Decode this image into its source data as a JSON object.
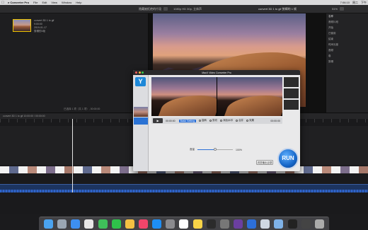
{
  "menubar": {
    "apple": "",
    "app_name": "e Converter Pro",
    "menus": [
      "File",
      "Edit",
      "View",
      "Window",
      "Help"
    ],
    "status_right": [
      "7:06:10",
      "周二",
      "下午"
    ]
  },
  "fcp_toolbar": {
    "library_title": "隐藏被拒绝的片段",
    "viewer_meta": "1080p HD 30p, 立体声",
    "project_name": "convert 3D 1 to gif 剪辑的 1 帧",
    "zoom": "51%",
    "view": "显示"
  },
  "browser": {
    "clip_name": "convert 3D 1 to gif",
    "clip_meta": [
      "9:00:00",
      "2019-01-17",
      "剪辑的1帧"
    ],
    "footer": "已选择 1 项（共 1 项）, 00:00:00"
  },
  "inspector": {
    "rows": [
      "名称",
      "音频片段",
      "开始",
      "已使用",
      "结束",
      "时间长度",
      "音频",
      "卷",
      "剪辑"
    ]
  },
  "timeline": {
    "header": "convert 3D 1 to gif 10:00:00 / 00:00:00"
  },
  "converter": {
    "title": "MacX Video Converter Pro",
    "logo": "Y",
    "controls": {
      "play": "▶",
      "time_start": "00:00:00",
      "selected_tab": "Basic Setting",
      "options": [
        "旋转",
        "剪切",
        "添加水印",
        "合并",
        "效果"
      ],
      "time_end": "00:00:00"
    },
    "slider": {
      "label": "音量",
      "value": 0.5,
      "readout": "100%"
    },
    "output_button": "浏览输出目录",
    "run_button": "RUN"
  },
  "dock": {
    "icons": [
      "finder-icon",
      "launchpad-icon",
      "safari-icon",
      "chrome-icon",
      "messages-icon",
      "wechat-icon",
      "photos-icon",
      "music-icon",
      "appstore-icon",
      "prefs-icon",
      "calendar-icon",
      "notes-icon",
      "finalcut-icon",
      "compressor-icon",
      "motion-icon",
      "converter-icon",
      "quicktime-icon",
      "preview-icon",
      "terminal-icon",
      "activity-icon",
      "trash-icon"
    ]
  }
}
